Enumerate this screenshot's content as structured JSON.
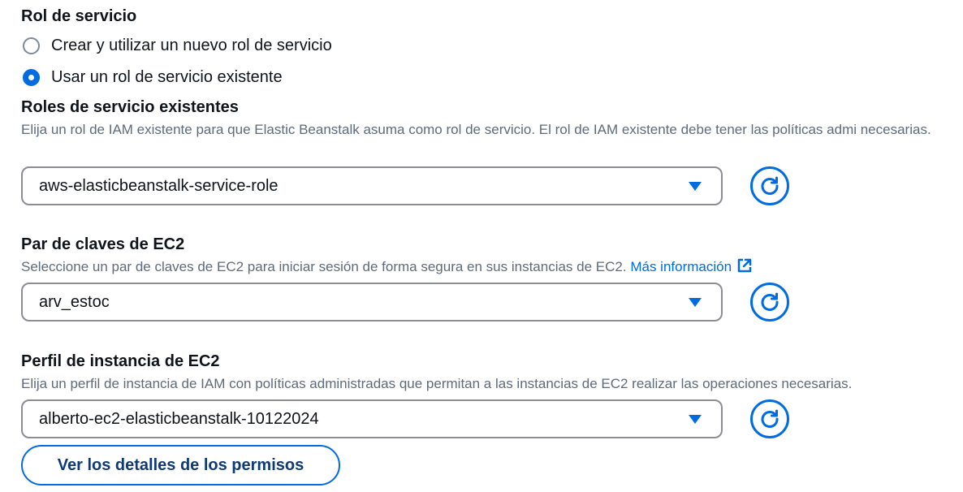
{
  "service_role": {
    "heading": "Rol de servicio",
    "options": [
      {
        "label": "Crear y utilizar un nuevo rol de servicio",
        "selected": false
      },
      {
        "label": "Usar un rol de servicio existente",
        "selected": true
      }
    ]
  },
  "existing_roles": {
    "heading": "Roles de servicio existentes",
    "description": "Elija un rol de IAM existente para que Elastic Beanstalk asuma como rol de servicio. El rol de IAM existente debe tener las políticas admi necesarias.",
    "selected_value": "aws-elasticbeanstalk-service-role"
  },
  "ec2_key_pair": {
    "heading": "Par de claves de EC2",
    "description": "Seleccione un par de claves de EC2 para iniciar sesión de forma segura en sus instancias de EC2.",
    "link_label": "Más información",
    "selected_value": "arv_estoc"
  },
  "ec2_instance_profile": {
    "heading": "Perfil de instancia de EC2",
    "description": "Elija un perfil de instancia de IAM con políticas administradas que permitan a las instancias de EC2 realizar las operaciones necesarias.",
    "selected_value": "alberto-ec2-elasticbeanstalk-10122024"
  },
  "view_permissions_button": "Ver los detalles de los permisos",
  "colors": {
    "accent": "#006ce0",
    "text": "#0f141a",
    "muted": "#5f6b7a",
    "border": "#8c8c94"
  },
  "icons": {
    "dropdown": "caret-down-icon",
    "refresh": "refresh-icon",
    "external_link": "external-link-icon"
  }
}
